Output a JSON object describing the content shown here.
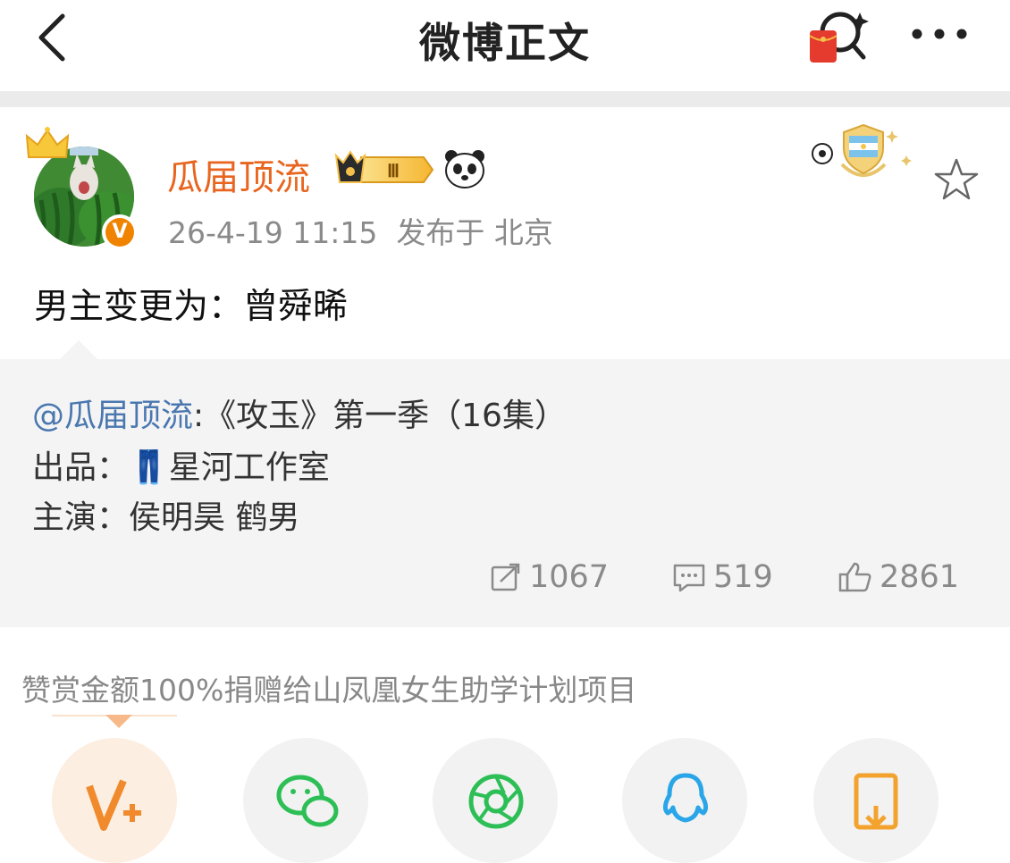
{
  "nav": {
    "title": "微博正文",
    "back_icon": "chevron-left-icon",
    "more_icon": "more-dots-icon",
    "redpack_icon": "red-packet-search-icon"
  },
  "post": {
    "username": "瓜届顶流",
    "level_badge": "Ⅲ",
    "time": "26-4-19 11:15",
    "location": "发布于 北京",
    "content": "男主变更为：曾舜晞",
    "verified_mark": "V"
  },
  "repost": {
    "mention": "@瓜届顶流",
    "line1_rest": ":《攻玉》第一季（16集）",
    "line2_label": "出品：",
    "line2_emoji": "👖",
    "line2_value": "星河工作室",
    "line3": "主演：侯明昊 鹤男",
    "stats": {
      "reposts": "1067",
      "comments": "519",
      "likes": "2861"
    }
  },
  "donate": {
    "text": "赞赏金额100%捐赠给山凤凰女生助学计划项目"
  },
  "colors": {
    "accent": "#e8651f",
    "link": "#4a77b0",
    "meta": "#8a8a8a"
  }
}
